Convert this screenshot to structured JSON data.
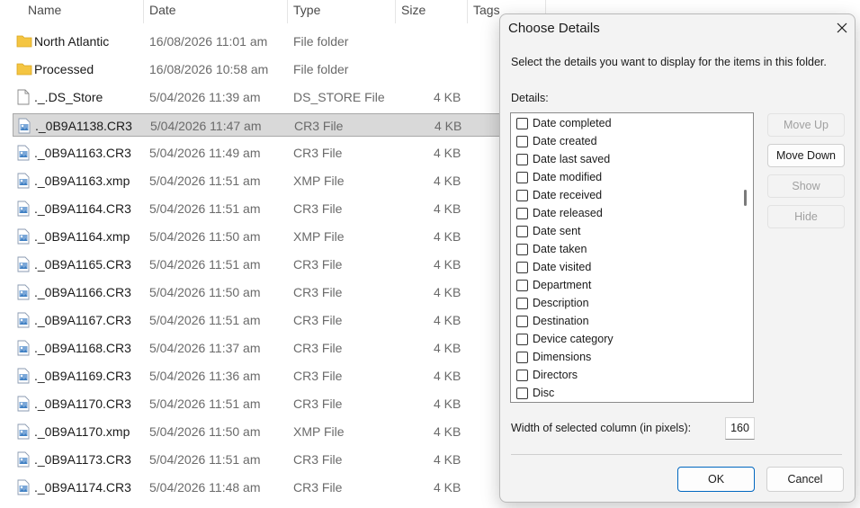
{
  "explorer": {
    "columns": {
      "name": "Name",
      "date": "Date",
      "type": "Type",
      "size": "Size",
      "tags": "Tags"
    },
    "rows": [
      {
        "name": "North Atlantic",
        "date": "16/08/2026 11:01 am",
        "type": "File folder",
        "size": "",
        "icon": "folder-icon"
      },
      {
        "name": "Processed",
        "date": "16/08/2026 10:58 am",
        "type": "File folder",
        "size": "",
        "icon": "folder-icon"
      },
      {
        "name": "._.DS_Store",
        "date": "5/04/2026 11:39 am",
        "type": "DS_STORE File",
        "size": "4 KB",
        "icon": "file-icon"
      },
      {
        "name": "._0B9A1138.CR3",
        "date": "5/04/2026 11:47 am",
        "type": "CR3 File",
        "size": "4 KB",
        "icon": "image-file-icon"
      },
      {
        "name": "._0B9A1163.CR3",
        "date": "5/04/2026 11:49 am",
        "type": "CR3 File",
        "size": "4 KB",
        "icon": "image-file-icon"
      },
      {
        "name": "._0B9A1163.xmp",
        "date": "5/04/2026 11:51 am",
        "type": "XMP File",
        "size": "4 KB",
        "icon": "image-file-icon"
      },
      {
        "name": "._0B9A1164.CR3",
        "date": "5/04/2026 11:51 am",
        "type": "CR3 File",
        "size": "4 KB",
        "icon": "image-file-icon"
      },
      {
        "name": "._0B9A1164.xmp",
        "date": "5/04/2026 11:50 am",
        "type": "XMP File",
        "size": "4 KB",
        "icon": "image-file-icon"
      },
      {
        "name": "._0B9A1165.CR3",
        "date": "5/04/2026 11:51 am",
        "type": "CR3 File",
        "size": "4 KB",
        "icon": "image-file-icon"
      },
      {
        "name": "._0B9A1166.CR3",
        "date": "5/04/2026 11:50 am",
        "type": "CR3 File",
        "size": "4 KB",
        "icon": "image-file-icon"
      },
      {
        "name": "._0B9A1167.CR3",
        "date": "5/04/2026 11:51 am",
        "type": "CR3 File",
        "size": "4 KB",
        "icon": "image-file-icon"
      },
      {
        "name": "._0B9A1168.CR3",
        "date": "5/04/2026 11:37 am",
        "type": "CR3 File",
        "size": "4 KB",
        "icon": "image-file-icon"
      },
      {
        "name": "._0B9A1169.CR3",
        "date": "5/04/2026 11:36 am",
        "type": "CR3 File",
        "size": "4 KB",
        "icon": "image-file-icon"
      },
      {
        "name": "._0B9A1170.CR3",
        "date": "5/04/2026 11:51 am",
        "type": "CR3 File",
        "size": "4 KB",
        "icon": "image-file-icon"
      },
      {
        "name": "._0B9A1170.xmp",
        "date": "5/04/2026 11:50 am",
        "type": "XMP File",
        "size": "4 KB",
        "icon": "image-file-icon"
      },
      {
        "name": "._0B9A1173.CR3",
        "date": "5/04/2026 11:51 am",
        "type": "CR3 File",
        "size": "4 KB",
        "icon": "image-file-icon"
      },
      {
        "name": "._0B9A1174.CR3",
        "date": "5/04/2026 11:48 am",
        "type": "CR3 File",
        "size": "4 KB",
        "icon": "image-file-icon"
      }
    ]
  },
  "dialog": {
    "title": "Choose Details",
    "description": "Select the details you want to display for the items in this folder.",
    "details_label": "Details:",
    "items": [
      {
        "label": "Date completed",
        "checked": false
      },
      {
        "label": "Date created",
        "checked": false
      },
      {
        "label": "Date last saved",
        "checked": false
      },
      {
        "label": "Date modified",
        "checked": false
      },
      {
        "label": "Date received",
        "checked": false
      },
      {
        "label": "Date released",
        "checked": false
      },
      {
        "label": "Date sent",
        "checked": false
      },
      {
        "label": "Date taken",
        "checked": false
      },
      {
        "label": "Date visited",
        "checked": false
      },
      {
        "label": "Department",
        "checked": false
      },
      {
        "label": "Description",
        "checked": false
      },
      {
        "label": "Destination",
        "checked": false
      },
      {
        "label": "Device category",
        "checked": false
      },
      {
        "label": "Dimensions",
        "checked": false
      },
      {
        "label": "Directors",
        "checked": false
      },
      {
        "label": "Disc",
        "checked": false
      }
    ],
    "buttons": {
      "move_up": "Move Up",
      "move_down": "Move Down",
      "show": "Show",
      "hide": "Hide",
      "ok": "OK",
      "cancel": "Cancel"
    },
    "width_label": "Width of selected column (in pixels):",
    "width_value": "160"
  }
}
